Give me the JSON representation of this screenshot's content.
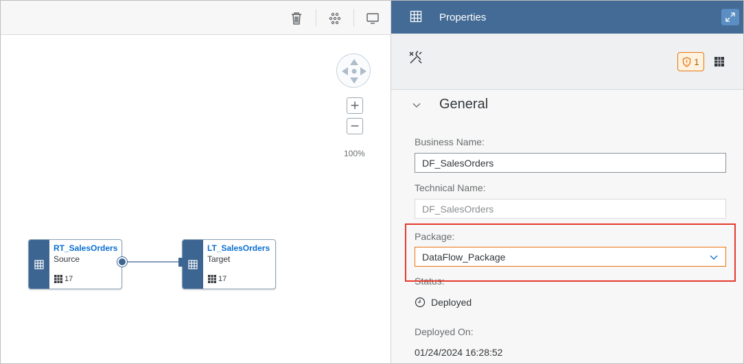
{
  "canvas": {
    "toolbar": {
      "delete_icon": "trash-icon",
      "layout_icon": "auto-layout-icon",
      "screen_icon": "monitor-icon"
    },
    "zoom": {
      "level": "100%",
      "in": "+",
      "out": "−"
    },
    "nodes": [
      {
        "name": "RT_SalesOrders",
        "kind": "Source",
        "count": "17"
      },
      {
        "name": "LT_SalesOrders",
        "kind": "Target",
        "count": "17"
      }
    ]
  },
  "panel": {
    "title": "Properties",
    "warning_count": "1",
    "section": "General",
    "fields": {
      "business_name_label": "Business Name:",
      "business_name": "DF_SalesOrders",
      "technical_name_label": "Technical Name:",
      "technical_name": "DF_SalesOrders",
      "package_label": "Package:",
      "package": "DataFlow_Package",
      "status_label": "Status:",
      "status": "Deployed",
      "deployed_on_label": "Deployed On:",
      "deployed_on": "01/24/2024 16:28:52"
    }
  },
  "colors": {
    "panel_header": "#436b95",
    "node_stripe": "#3c6592",
    "node_title": "#0a6ed1",
    "warning": "#e9730c",
    "highlight": "#e5392c"
  }
}
